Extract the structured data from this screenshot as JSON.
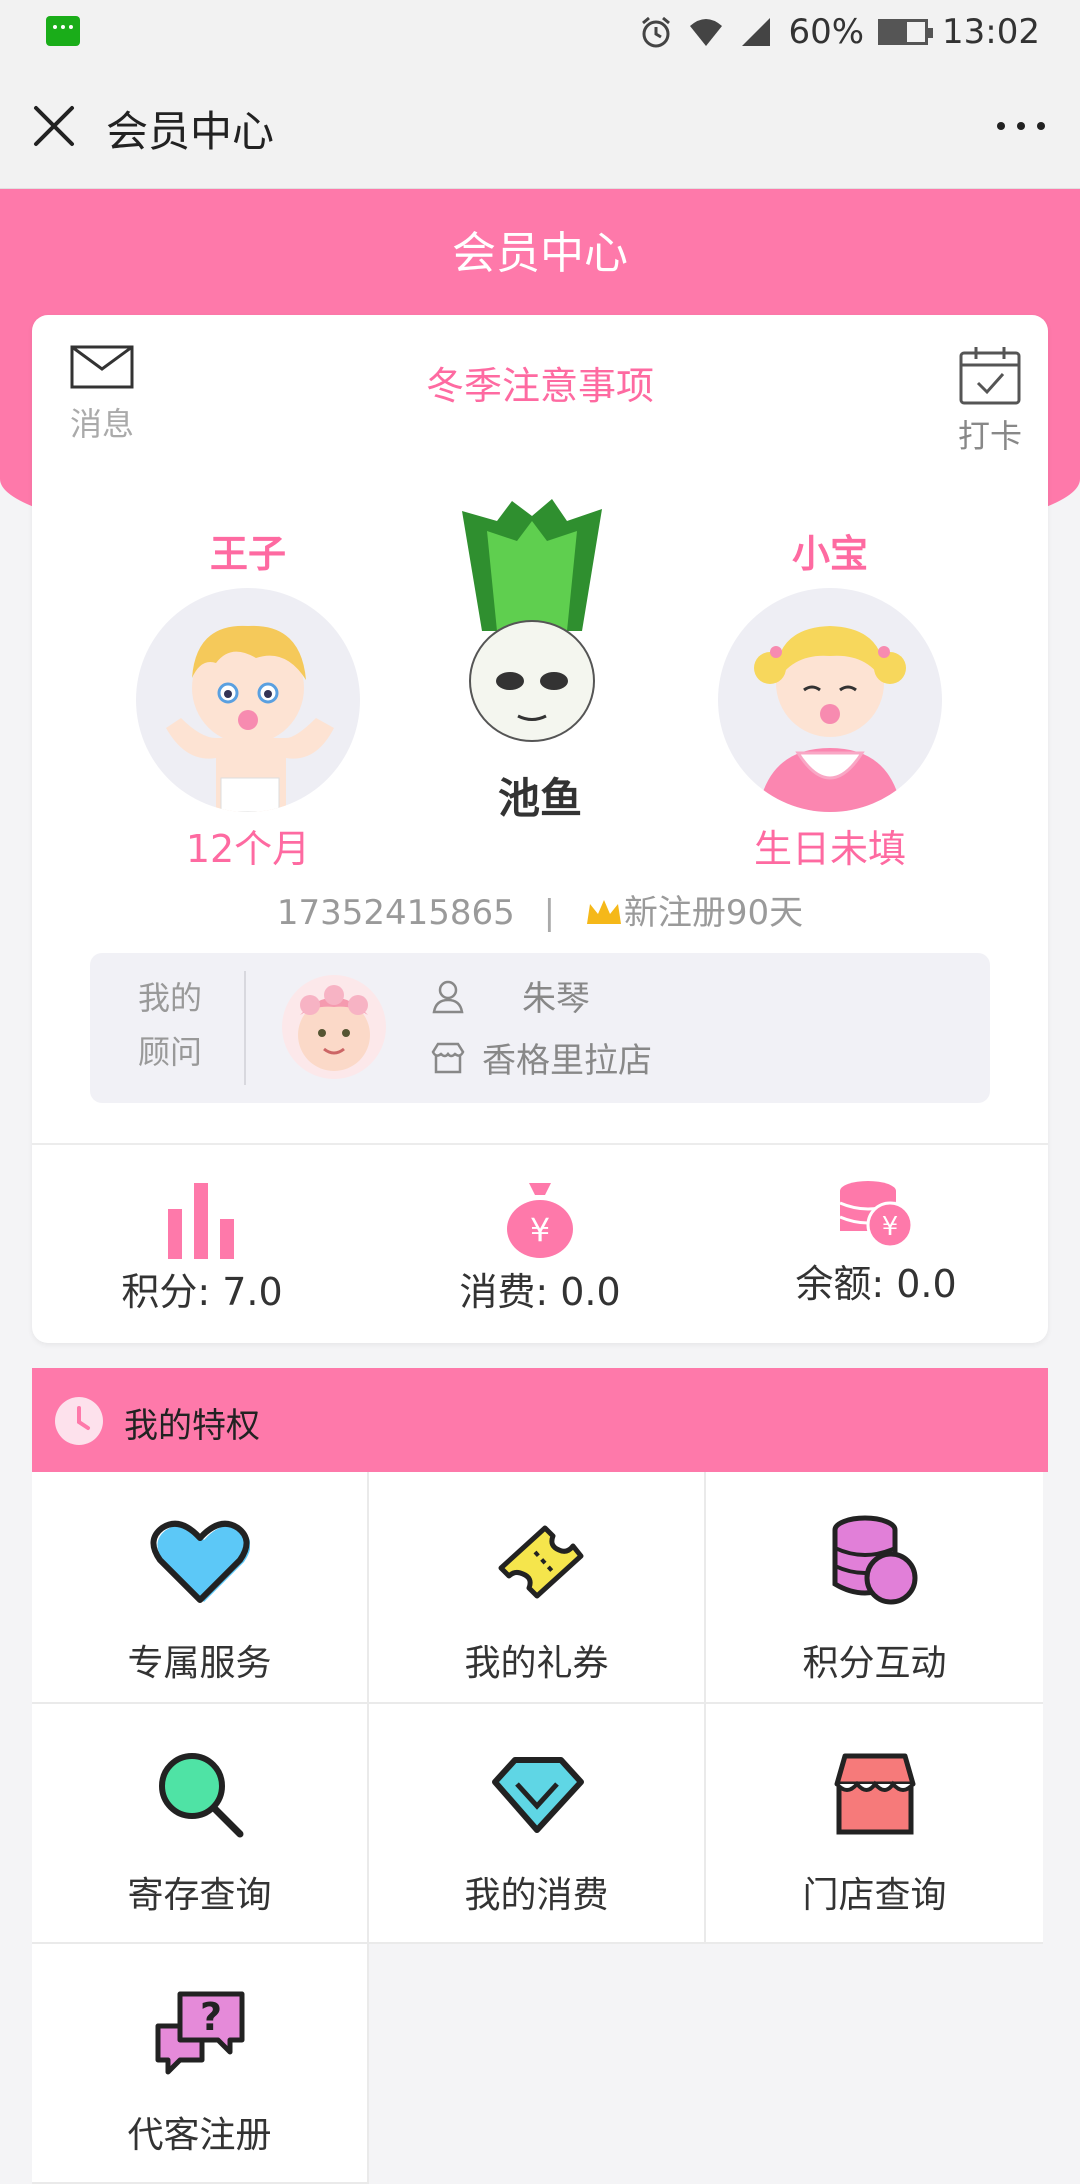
{
  "status_bar": {
    "battery": "60%",
    "time": "13:02"
  },
  "title_bar": {
    "title": "会员中心"
  },
  "header": {
    "title": "会员中心"
  },
  "card": {
    "message_label": "消息",
    "notice": "冬季注意事项",
    "checkin_label": "打卡",
    "children": [
      {
        "name": "王子",
        "sub": "12个月"
      },
      {
        "name": "小宝",
        "sub": "生日未填"
      }
    ],
    "user": {
      "name": "池鱼",
      "phone": "17352415865",
      "separator": "|",
      "status": "新注册90天"
    },
    "advisor": {
      "label_line1": "我的",
      "label_line2": "顾问",
      "name": "朱琴",
      "store": "香格里拉店"
    },
    "stats": [
      {
        "label": "积分: 7.0"
      },
      {
        "label": "消费: 0.0"
      },
      {
        "label": "余额: 0.0"
      }
    ]
  },
  "privileges": {
    "title": "我的特权",
    "items": [
      {
        "label": "专属服务",
        "icon": "heart-icon"
      },
      {
        "label": "我的礼券",
        "icon": "ticket-icon"
      },
      {
        "label": "积分互动",
        "icon": "coins-icon"
      },
      {
        "label": "寄存查询",
        "icon": "magnifier-icon"
      },
      {
        "label": "我的消费",
        "icon": "diamond-icon"
      },
      {
        "label": "门店查询",
        "icon": "store-icon"
      },
      {
        "label": "代客注册",
        "icon": "chat-question-icon"
      }
    ]
  },
  "colors": {
    "accent": "#fe79aa",
    "accent_text": "#fe6aa1"
  }
}
